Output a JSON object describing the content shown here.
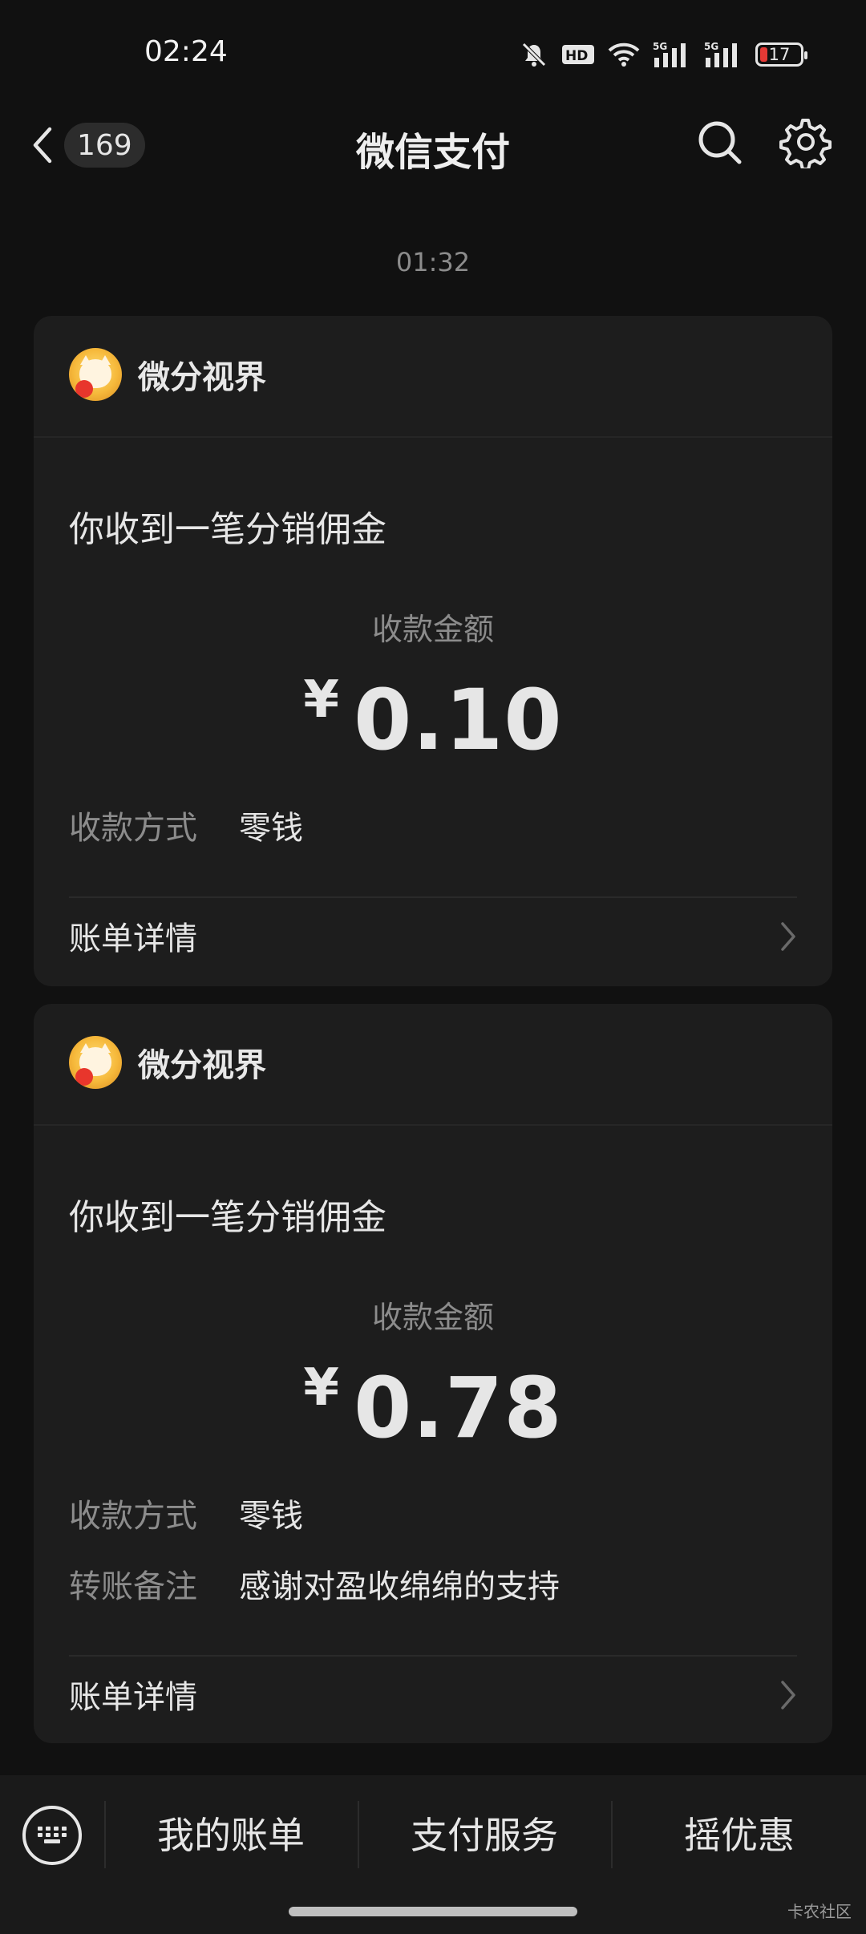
{
  "status_bar": {
    "time": "02:24",
    "icons": [
      "mute-bell-icon",
      "hd-icon",
      "wifi-icon",
      "5g-signal-icon",
      "5g-signal-icon",
      "battery-icon"
    ],
    "hd_label": "HD",
    "network_label": "5G",
    "battery_level": "17"
  },
  "header": {
    "back_count": "169",
    "title": "微信支付"
  },
  "timestamp": "01:32",
  "cards": [
    {
      "merchant": "微分视界",
      "title": "你收到一笔分销佣金",
      "amount_label": "收款金额",
      "currency_symbol": "¥",
      "amount": "0.10",
      "method_label": "收款方式",
      "method_value": "零钱",
      "detail_label": "账单详情"
    },
    {
      "merchant": "微分视界",
      "title": "你收到一笔分销佣金",
      "amount_label": "收款金额",
      "currency_symbol": "¥",
      "amount": "0.78",
      "method_label": "收款方式",
      "method_value": "零钱",
      "note_label": "转账备注",
      "note_value": "感谢对盈收绵绵的支持",
      "detail_label": "账单详情"
    }
  ],
  "bottom_bar": {
    "items": [
      "我的账单",
      "支付服务",
      "摇优惠"
    ]
  },
  "watermark": "卡农社区",
  "colors": {
    "background": "#111111",
    "card": "#1d1d1d",
    "text_primary": "#e6e6e6",
    "text_secondary": "#8c8c8c",
    "battery_low": "#e53935"
  }
}
